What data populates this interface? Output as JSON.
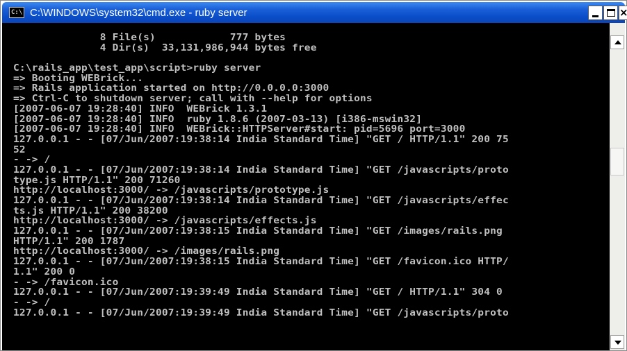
{
  "window": {
    "title": "C:\\WINDOWS\\system32\\cmd.exe - ruby server",
    "icon_label": "C:\\",
    "icon": "cmd-icon",
    "controls": {
      "minimize_icon": "minimize-icon",
      "maximize_icon": "maximize-icon",
      "close_icon": "close-icon",
      "close_glyph": "×"
    }
  },
  "colors": {
    "titlebar": "#0a4ec9",
    "console_bg": "#000000",
    "console_text": "#c0c0c0"
  },
  "console": {
    "lines": [
      "              8 File(s)            777 bytes",
      "              4 Dir(s)  33,131,986,944 bytes free",
      "",
      "C:\\rails_app\\test_app\\script>ruby server",
      "=> Booting WEBrick...",
      "=> Rails application started on http://0.0.0.0:3000",
      "=> Ctrl-C to shutdown server; call with --help for options",
      "[2007-06-07 19:28:40] INFO  WEBrick 1.3.1",
      "[2007-06-07 19:28:40] INFO  ruby 1.8.6 (2007-03-13) [i386-mswin32]",
      "[2007-06-07 19:28:40] INFO  WEBrick::HTTPServer#start: pid=5696 port=3000",
      "127.0.0.1 - - [07/Jun/2007:19:38:14 India Standard Time] \"GET / HTTP/1.1\" 200 75",
      "52",
      "- -> /",
      "127.0.0.1 - - [07/Jun/2007:19:38:14 India Standard Time] \"GET /javascripts/proto",
      "type.js HTTP/1.1\" 200 71260",
      "http://localhost:3000/ -> /javascripts/prototype.js",
      "127.0.0.1 - - [07/Jun/2007:19:38:14 India Standard Time] \"GET /javascripts/effec",
      "ts.js HTTP/1.1\" 200 38200",
      "http://localhost:3000/ -> /javascripts/effects.js",
      "127.0.0.1 - - [07/Jun/2007:19:38:15 India Standard Time] \"GET /images/rails.png ",
      "HTTP/1.1\" 200 1787",
      "http://localhost:3000/ -> /images/rails.png",
      "127.0.0.1 - - [07/Jun/2007:19:38:15 India Standard Time] \"GET /favicon.ico HTTP/",
      "1.1\" 200 0",
      "- -> /favicon.ico",
      "127.0.0.1 - - [07/Jun/2007:19:39:49 India Standard Time] \"GET / HTTP/1.1\" 304 0",
      "- -> /",
      "127.0.0.1 - - [07/Jun/2007:19:39:49 India Standard Time] \"GET /javascripts/proto"
    ]
  },
  "scrollbar": {
    "up_icon": "scroll-up-arrow-icon",
    "down_icon": "scroll-down-arrow-icon"
  }
}
